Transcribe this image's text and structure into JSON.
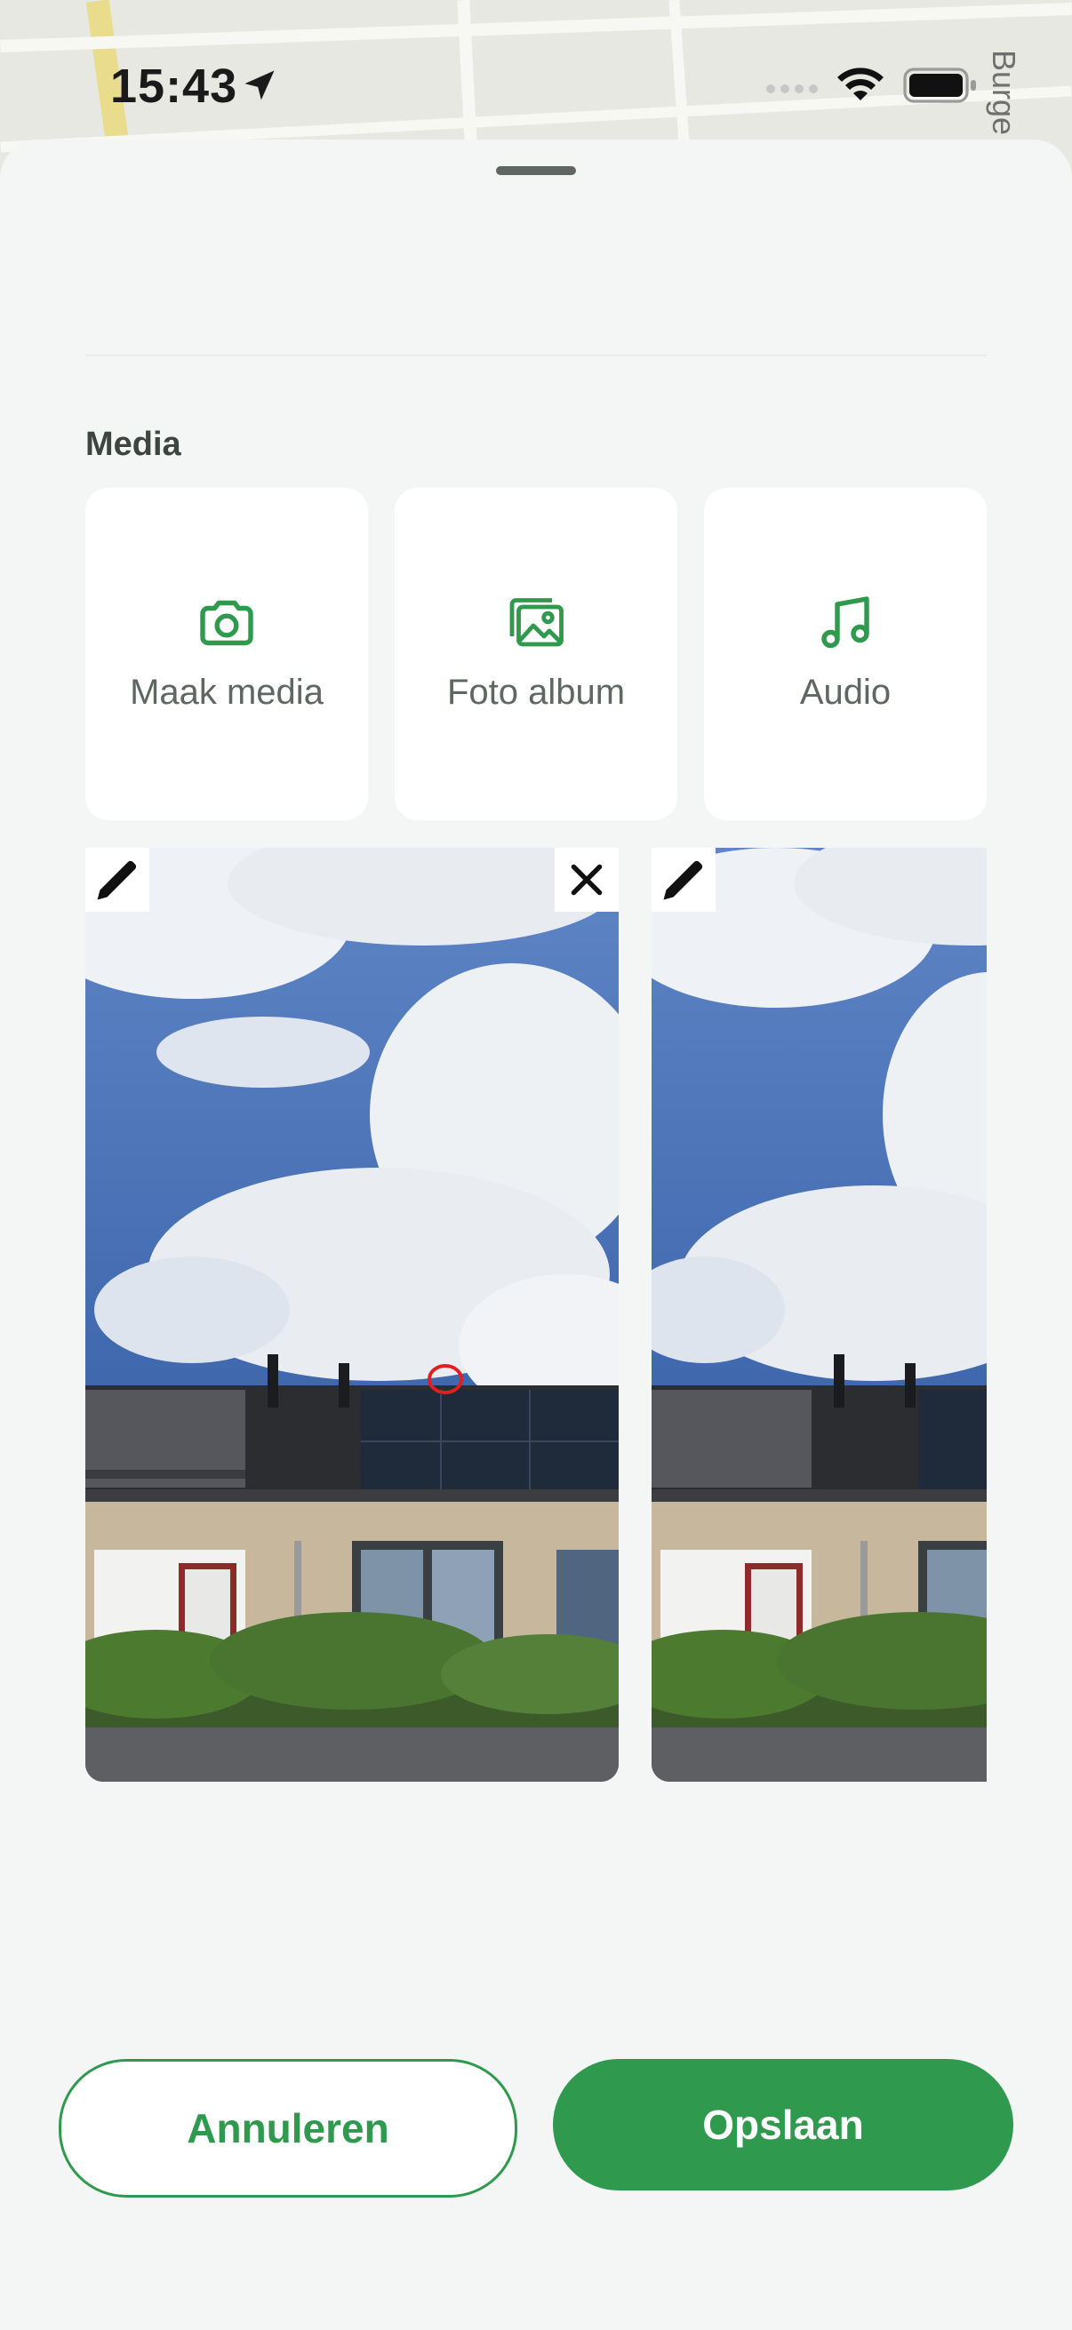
{
  "status_bar": {
    "time": "15:43"
  },
  "map": {
    "street_label": "Burge"
  },
  "media": {
    "section_title": "Media",
    "tiles": [
      {
        "label": "Maak media",
        "icon": "camera-icon"
      },
      {
        "label": "Foto album",
        "icon": "photo-album-icon"
      },
      {
        "label": "Audio",
        "icon": "music-note-icon"
      }
    ],
    "photos": [
      {
        "edit_icon": "pencil-icon",
        "remove_icon": "close-icon"
      },
      {
        "edit_icon": "pencil-icon"
      }
    ]
  },
  "actions": {
    "cancel_label": "Annuleren",
    "save_label": "Opslaan"
  },
  "colors": {
    "accent": "#2f9a4d",
    "sheet": "#f4f6f5",
    "text_muted": "#5e6762"
  }
}
